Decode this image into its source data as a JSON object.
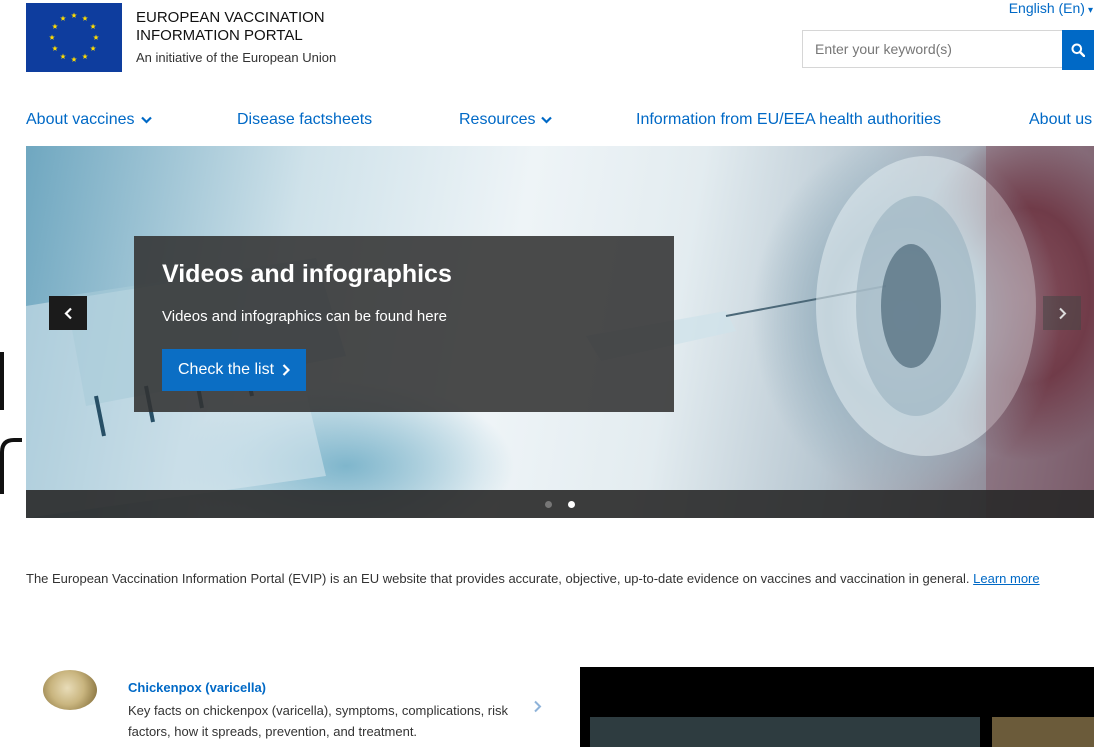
{
  "header": {
    "brand_line1": "EUROPEAN VACCINATION",
    "brand_line2": "INFORMATION PORTAL",
    "brand_sub": "An initiative of the European Union",
    "language": "English (En)",
    "search_placeholder": "Enter your keyword(s)",
    "icons": {
      "flag": "eu-flag-icon",
      "search": "search-icon",
      "caret": "caret-down-icon"
    }
  },
  "nav": {
    "items": [
      {
        "label": "About vaccines",
        "has_dropdown": true
      },
      {
        "label": "Disease factsheets",
        "has_dropdown": false
      },
      {
        "label": "Resources",
        "has_dropdown": true
      },
      {
        "label": "Information from EU/EEA health authorities",
        "has_dropdown": false
      },
      {
        "label": "About us",
        "has_dropdown": false
      }
    ]
  },
  "hero": {
    "title": "Videos and infographics",
    "text": "Videos and infographics can be found here",
    "button_label": "Check the list",
    "slides_total": 2,
    "active_slide": 2
  },
  "intro": {
    "text": "The European Vaccination Information Portal (EVIP) is an EU website that provides accurate, objective, up-to-date evidence on vaccines and vaccination in general. ",
    "link_label": "Learn more"
  },
  "feature": {
    "title": "Chickenpox (varicella)",
    "text": "Key facts on chickenpox (varicella), symptoms, complications, risk factors, how it spreads, prevention, and treatment."
  },
  "colors": {
    "primary": "#0069c6",
    "flag": "#0e3d9e",
    "star": "#ffdd00",
    "card": "#323232"
  }
}
